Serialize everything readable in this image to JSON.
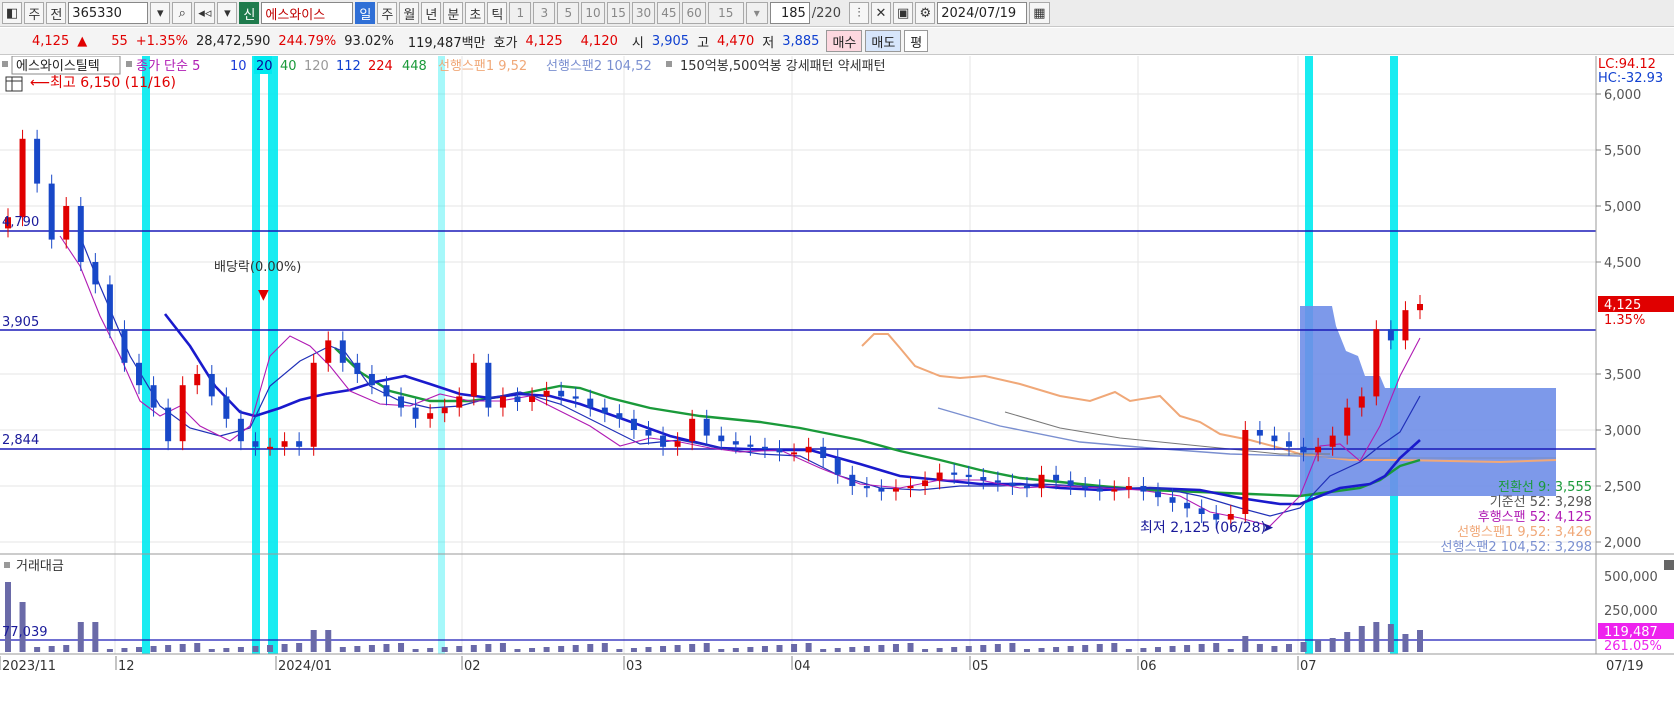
{
  "toolbar": {
    "type_label": "주",
    "prev_label": "전",
    "stock_code": "365330",
    "new_badge": "신",
    "stock_name": "에스와이스",
    "periods": [
      "일",
      "주",
      "월",
      "년",
      "분",
      "초",
      "틱"
    ],
    "active_period": "일",
    "intervals": [
      "1",
      "3",
      "5",
      "10",
      "15",
      "30",
      "45",
      "60"
    ],
    "interval_select": "15",
    "count": "185",
    "count_total": "/220",
    "date": "2024/07/19"
  },
  "quote": {
    "price": "4,125",
    "change": "55",
    "change_pct": "+1.35%",
    "volume": "28,472,590",
    "volume_ratio": "244.79%",
    "turnover": "93.02%",
    "amount": "119,487백만",
    "ask_label": "호가",
    "ask": "4,125",
    "bid": "4,120",
    "open_label": "시",
    "open": "3,905",
    "high_label": "고",
    "high": "4,470",
    "low_label": "저",
    "low": "3,885",
    "buy_label": "매수",
    "sell_label": "매도",
    "flat_label": "평"
  },
  "colors": {
    "up": "#e00000",
    "down": "#1848c8",
    "ma5": "#b01bb4",
    "ma10": "#1a3bd8",
    "ma20": "#0a0a9a",
    "ma40": "#1a9a3a",
    "span1": "#f0a878",
    "span2": "#7a8fd0",
    "cloud": "#6f8ee8",
    "highlight": "#00eaf0"
  },
  "legend": {
    "name": "에스와이스틸텍",
    "ma_label": "종가 단순 5",
    "ma_periods": [
      "10",
      "20",
      "40",
      "120",
      "112",
      "224",
      "448"
    ],
    "span1": "선행스팬1 9,52",
    "span2": "선행스팬2 104,52",
    "extra": "150억봉,500억봉 강세패턴 약세패턴"
  },
  "annotations": {
    "high_marker": "최고 6,150 (11/16)",
    "dividend": "배당락(0.00%)",
    "low_marker": "최저 2,125 (06/28)",
    "level_4790": "4,790",
    "level_3905": "3,905",
    "level_2844": "2,844",
    "vol_level": "77,039"
  },
  "right_axis": {
    "lc": "LC:94.12",
    "hc": "HC:-32.93",
    "ticks": [
      "6,000",
      "5,500",
      "5,000",
      "4,500",
      "3,500",
      "3,000",
      "2,500",
      "2,000"
    ],
    "price_tag": "4,125",
    "price_tag_pct": "1.35%",
    "vol_ticks": [
      "500,000",
      "250,000"
    ],
    "vol_tag": "119,487",
    "vol_tag_pct": "261.05%"
  },
  "ichimoku": {
    "conversion": "전환선 9: 3,555",
    "base": "기준선 52: 3,298",
    "lagging": "후행스팬 52: 4,125",
    "lead1": "선행스팬1 9,52: 3,426",
    "lead2": "선행스팬2 104,52: 3,298"
  },
  "volume_label": "거래대금",
  "x_labels": [
    "2023/11",
    "12",
    "2024/01",
    "02",
    "03",
    "04",
    "05",
    "06",
    "07"
  ],
  "x_end_label": "07/19",
  "chart_data": {
    "type": "candlestick",
    "y_range": [
      2000,
      6150
    ],
    "closes": [
      4900,
      5600,
      5200,
      4700,
      5000,
      4500,
      4300,
      3900,
      3600,
      3400,
      3200,
      2900,
      3400,
      3500,
      3300,
      3100,
      2900,
      2850,
      2850,
      2900,
      2850,
      3600,
      3800,
      3600,
      3500,
      3400,
      3300,
      3200,
      3100,
      3150,
      3200,
      3300,
      3600,
      3200,
      3300,
      3250,
      3300,
      3350,
      3300,
      3280,
      3200,
      3150,
      3100,
      3000,
      2950,
      2850,
      2900,
      3100,
      2950,
      2900,
      2870,
      2850,
      2830,
      2800,
      2800,
      2850,
      2750,
      2600,
      2500,
      2480,
      2450,
      2480,
      2500,
      2550,
      2620,
      2600,
      2580,
      2550,
      2530,
      2500,
      2480,
      2600,
      2550,
      2500,
      2480,
      2450,
      2470,
      2500,
      2450,
      2400,
      2350,
      2300,
      2250,
      2200,
      2250,
      3000,
      2950,
      2900,
      2850,
      2800,
      2850,
      2950,
      3200,
      3300,
      3900,
      3800,
      4070,
      4125
    ],
    "volume_note": "거래대금 bars, spike in July"
  }
}
